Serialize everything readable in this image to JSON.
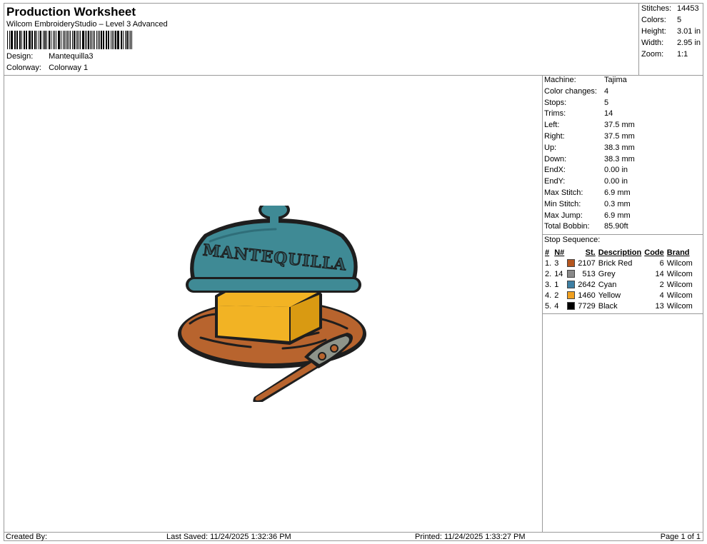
{
  "header": {
    "title": "Production Worksheet",
    "subtitle": "Wilcom EmbroideryStudio – Level 3 Advanced",
    "design_label": "Design:",
    "design_value": "Mantequilla3",
    "colorway_label": "Colorway:",
    "colorway_value": "Colorway 1"
  },
  "summary": [
    {
      "label": "Stitches:",
      "value": "14453"
    },
    {
      "label": "Colors:",
      "value": "5"
    },
    {
      "label": "Height:",
      "value": "3.01 in"
    },
    {
      "label": "Width:",
      "value": "2.95 in"
    },
    {
      "label": "Zoom:",
      "value": "1:1"
    }
  ],
  "design": {
    "text": "MANTEQUILLA",
    "colors": {
      "cyan": "#3f8a95",
      "cyan_dark": "#2f6e79",
      "yellow": "#f2b324",
      "yellow_dark": "#d99a12",
      "brick": "#b8642e",
      "brick_dark": "#8f4a1f",
      "grey": "#8e948a",
      "black": "#1e1e1e"
    }
  },
  "machine_info": [
    {
      "label": "Machine:",
      "value": "Tajima"
    },
    {
      "label": "Color changes:",
      "value": "4"
    },
    {
      "label": "Stops:",
      "value": "5"
    },
    {
      "label": "Trims:",
      "value": "14"
    },
    {
      "label": "Left:",
      "value": "37.5 mm"
    },
    {
      "label": "Right:",
      "value": "37.5 mm"
    },
    {
      "label": "Up:",
      "value": "38.3 mm"
    },
    {
      "label": "Down:",
      "value": "38.3 mm"
    },
    {
      "label": "EndX:",
      "value": "0.00 in"
    },
    {
      "label": "EndY:",
      "value": "0.00 in"
    },
    {
      "label": "Max Stitch:",
      "value": "6.9 mm"
    },
    {
      "label": "Min Stitch:",
      "value": "0.3 mm"
    },
    {
      "label": "Max Jump:",
      "value": "6.9 mm"
    },
    {
      "label": "Total Bobbin:",
      "value": "85.90ft"
    }
  ],
  "stop_sequence": {
    "title": "Stop Sequence:",
    "headers": {
      "num": "#",
      "needle": "N#",
      "stitches": "St.",
      "description": "Description",
      "code": "Code",
      "brand": "Brand"
    },
    "rows": [
      {
        "num": "1.",
        "needle": "3",
        "color": "#b5561f",
        "stitches": "2107",
        "description": "Brick Red",
        "code": "6",
        "brand": "Wilcom"
      },
      {
        "num": "2.",
        "needle": "14",
        "color": "#8a8a8a",
        "stitches": "513",
        "description": "Grey",
        "code": "14",
        "brand": "Wilcom"
      },
      {
        "num": "3.",
        "needle": "1",
        "color": "#3e7fa3",
        "stitches": "2642",
        "description": "Cyan",
        "code": "2",
        "brand": "Wilcom"
      },
      {
        "num": "4.",
        "needle": "2",
        "color": "#f0a020",
        "stitches": "1460",
        "description": "Yellow",
        "code": "4",
        "brand": "Wilcom"
      },
      {
        "num": "5.",
        "needle": "4",
        "color": "#000000",
        "stitches": "7729",
        "description": "Black",
        "code": "13",
        "brand": "Wilcom"
      }
    ]
  },
  "footer": {
    "created_by": "Created By:",
    "last_saved": "Last Saved: 11/24/2025 1:32:36 PM",
    "printed": "Printed: 11/24/2025 1:33:27 PM",
    "page": "Page 1 of 1"
  }
}
